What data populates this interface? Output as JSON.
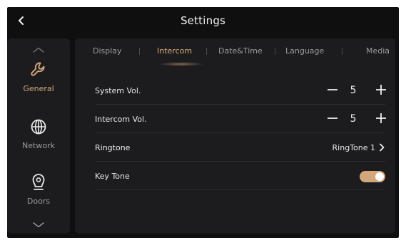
{
  "header": {
    "title": "Settings",
    "back_icon": "chevron-left-icon"
  },
  "sidebar": {
    "up_icon": "chevron-up-icon",
    "down_icon": "chevron-down-icon",
    "items": [
      {
        "label": "General",
        "icon": "wrench-icon",
        "active": true
      },
      {
        "label": "Network",
        "icon": "globe-icon",
        "active": false
      },
      {
        "label": "Doors",
        "icon": "doorbell-camera-icon",
        "active": false
      }
    ]
  },
  "tabs": [
    {
      "label": "Display",
      "active": false
    },
    {
      "label": "Intercom",
      "active": true
    },
    {
      "label": "Date&Time",
      "active": false
    },
    {
      "label": "Language",
      "active": false
    },
    {
      "label": "Media",
      "active": false
    }
  ],
  "settings": {
    "system_vol": {
      "label": "System Vol.",
      "value": "5",
      "minus": "−",
      "plus": "+"
    },
    "intercom_vol": {
      "label": "Intercom Vol.",
      "value": "5",
      "minus": "−",
      "plus": "+"
    },
    "ringtone": {
      "label": "Ringtone",
      "value": "RingTone 1"
    },
    "key_tone": {
      "label": "Key Tone",
      "enabled": true
    }
  },
  "colors": {
    "accent": "#d2a77a",
    "background": "#0f0f10",
    "panel": "#1c1c1e",
    "text_primary": "#f2f2f2",
    "text_secondary": "#9a9a9a"
  }
}
